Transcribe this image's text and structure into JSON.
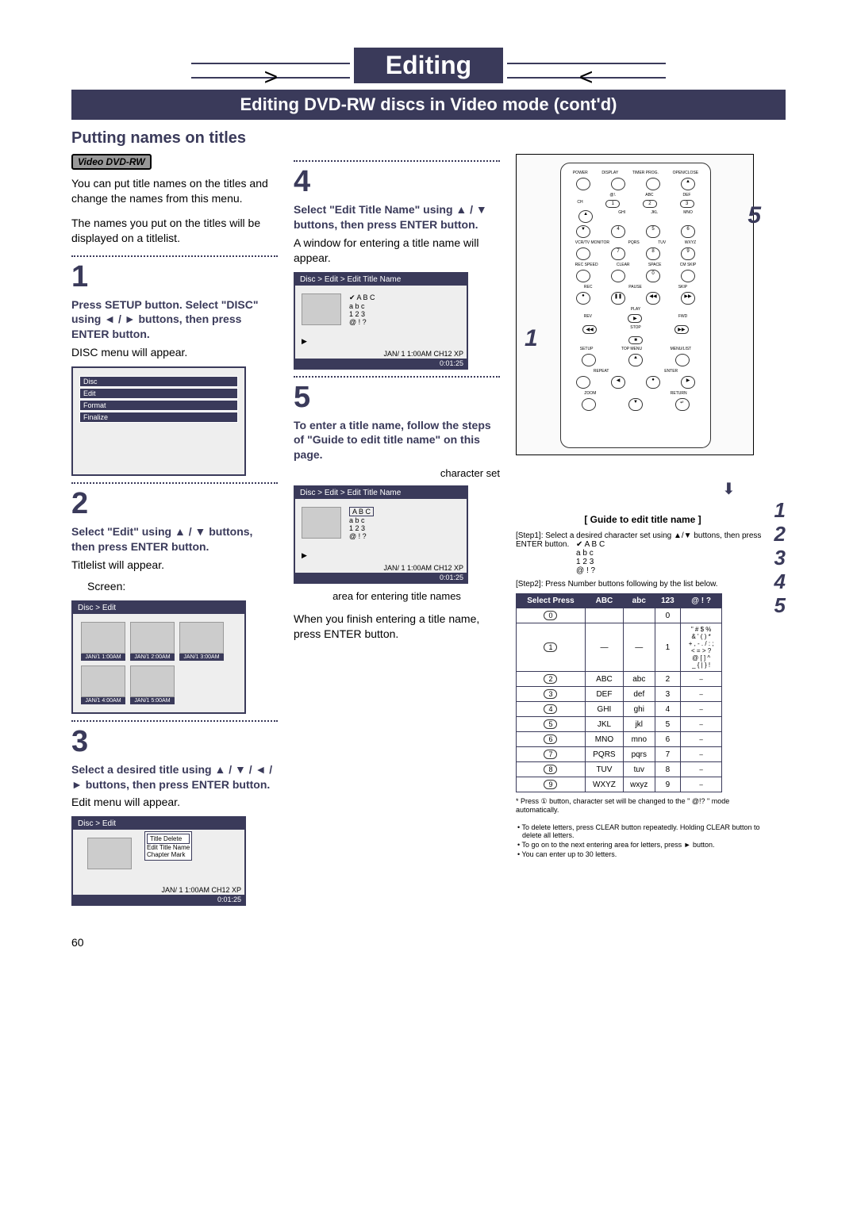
{
  "page": {
    "title": "Editing",
    "subtitle": "Editing DVD-RW discs in Video mode (cont'd)",
    "section_heading": "Putting names on titles",
    "page_number": "60"
  },
  "badge": {
    "label": "Video DVD-RW"
  },
  "intro": {
    "p1": "You can put title names on the titles and change the names from this menu.",
    "p2": "The names you put on the titles will be displayed on a titlelist."
  },
  "step1": {
    "num": "1",
    "bold": "Press SETUP button. Select \"DISC\" using ◄ / ► buttons, then press ENTER button.",
    "text": "DISC menu will appear.",
    "screen": {
      "hdr": "Disc",
      "rows": [
        "Edit",
        "Format",
        "Finalize"
      ]
    }
  },
  "step2": {
    "num": "2",
    "bold": "Select \"Edit\" using ▲ / ▼ buttons, then press ENTER button.",
    "text": "Titlelist will appear.",
    "label": "Screen:",
    "screen": {
      "hdr": "Disc > Edit",
      "thumbs": [
        "JAN/1  1:00AM",
        "JAN/1  2:00AM",
        "JAN/1  3:00AM",
        "JAN/1  4:00AM",
        "JAN/1  5:00AM"
      ]
    }
  },
  "step3": {
    "num": "3",
    "bold": "Select a desired title using ▲ / ▼ / ◄ / ► buttons, then press ENTER button.",
    "text": "Edit menu will appear.",
    "screen": {
      "hdr": "Disc > Edit",
      "popup": [
        "Title Delete",
        "Edit Title Name",
        "Chapter Mark"
      ],
      "status": "JAN/ 1   1:00AM  CH12     XP",
      "timebar": "0:01:25"
    }
  },
  "step4": {
    "num": "4",
    "bold": "Select \"Edit Title Name\" using ▲ / ▼ buttons, then press ENTER button.",
    "text": "A window for entering a title name will appear.",
    "screen": {
      "hdr": "Disc > Edit > Edit Title Name",
      "charset": [
        "✔  A B C",
        "a b c",
        "1 2 3",
        "@ ! ?"
      ],
      "status": "JAN/ 1   1:00AM   CH12   XP",
      "timebar": "0:01:25"
    }
  },
  "step5": {
    "num": "5",
    "bold": "To enter a title name, follow the steps of \"Guide to edit title name\" on this page.",
    "note_charset": "character set",
    "note_area": "area for entering title names",
    "after": "When you finish entering a title name, press ENTER button.",
    "screen": {
      "hdr": "Disc > Edit > Edit Title Name",
      "charset": [
        "A B C",
        "a b c",
        "1 2 3",
        "@ ! ?"
      ],
      "status": "JAN/ 1   1:00AM   CH12   XP",
      "timebar": "0:01:25"
    }
  },
  "remote": {
    "callout_1": "1",
    "callout_5": "5",
    "side_list": "1\n2\n3\n4\n5",
    "labels": {
      "power": "POWER",
      "display": "DISPLAY",
      "timer": "TIMER PROG.",
      "open": "OPEN/CLOSE",
      "ch": "CH",
      "vcr": "VCR/TV MONITOR",
      "recspeed": "REC SPEED",
      "clear": "CLEAR",
      "space": "SPACE",
      "cmskip": "CM SKIP",
      "rec": "REC",
      "pause": "PAUSE",
      "skip": "SKIP",
      "play": "PLAY",
      "rev": "REV",
      "fwd": "FWD",
      "stop": "STOP",
      "setup": "SETUP",
      "topmenu": "TOP MENU",
      "menulist": "MENU/LIST",
      "repeat": "REPEAT",
      "enter": "ENTER",
      "return": "RETURN",
      "zoom": "ZOOM"
    },
    "numpad_row1": [
      "@!.",
      "ABC",
      "DEF"
    ],
    "numpad_row1n": [
      "1",
      "2",
      "3"
    ],
    "numpad_row2": [
      "GHI",
      "JKL",
      "MNO"
    ],
    "numpad_row2n": [
      "4",
      "5",
      "6"
    ],
    "numpad_row3": [
      "PQRS",
      "TUV",
      "WXYZ"
    ],
    "numpad_row3n": [
      "7",
      "8",
      "9"
    ],
    "zero": "0"
  },
  "guide": {
    "title": "[ Guide to edit title name ]",
    "step1": "[Step1]: Select a desired character set using ▲/▼ buttons, then press ENTER button.",
    "step1_charset": [
      "✔  A B C",
      "a b c",
      "1 2 3",
      "@ ! ?"
    ],
    "step2": "[Step2]: Press Number buttons following by the list below.",
    "table": {
      "headers": [
        "Select Press",
        "ABC",
        "abc",
        "123",
        "@ ! ?"
      ],
      "rows": [
        {
          "btn": "0",
          "c1": "<space>",
          "c2": "<space>",
          "c3": "0",
          "c4": "<space>"
        },
        {
          "btn": "1",
          "c1": "—",
          "c2": "—",
          "c3": "1",
          "c4": "\" # $ %\n& ' ( ) *\n+ , - . / : ;\n< = > ?\n@ [ ] ^\n_ { | } !"
        },
        {
          "btn": "2",
          "c1": "ABC",
          "c2": "abc",
          "c3": "2",
          "c4": "–"
        },
        {
          "btn": "3",
          "c1": "DEF",
          "c2": "def",
          "c3": "3",
          "c4": "–"
        },
        {
          "btn": "4",
          "c1": "GHI",
          "c2": "ghi",
          "c3": "4",
          "c4": "–"
        },
        {
          "btn": "5",
          "c1": "JKL",
          "c2": "jkl",
          "c3": "5",
          "c4": "–"
        },
        {
          "btn": "6",
          "c1": "MNO",
          "c2": "mno",
          "c3": "6",
          "c4": "–"
        },
        {
          "btn": "7",
          "c1": "PQRS",
          "c2": "pqrs",
          "c3": "7",
          "c4": "–"
        },
        {
          "btn": "8",
          "c1": "TUV",
          "c2": "tuv",
          "c3": "8",
          "c4": "–"
        },
        {
          "btn": "9",
          "c1": "WXYZ",
          "c2": "wxyz",
          "c3": "9",
          "c4": "–"
        }
      ]
    },
    "footnote": "* Press ① button, character set will be changed to the \" @!? \" mode automatically.",
    "notes": [
      "• To delete letters, press CLEAR button repeatedly. Holding CLEAR button to delete all letters.",
      "• To go on to the next entering area for letters, press ► button.",
      "• You can enter up to 30 letters."
    ]
  }
}
